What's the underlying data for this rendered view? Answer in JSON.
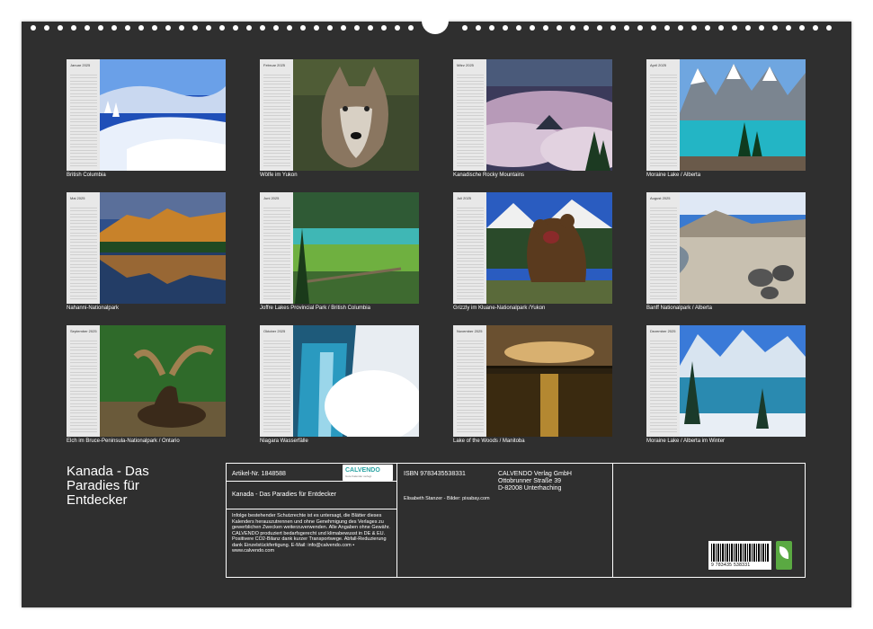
{
  "months": [
    {
      "month": "Januar 2025",
      "caption": "British Columbia",
      "scene": "snow"
    },
    {
      "month": "Februar 2025",
      "caption": "Wölfe im Yukon",
      "scene": "wolf"
    },
    {
      "month": "März 2025",
      "caption": "Kanadische Rocky Mountains",
      "scene": "clouds"
    },
    {
      "month": "April 2025",
      "caption": "Moraine Lake / Alberta",
      "scene": "lake"
    },
    {
      "month": "Mai 2025",
      "caption": "Nahanni-Nationalpark",
      "scene": "mountain-reflect"
    },
    {
      "month": "Juni 2025",
      "caption": "Joffre Lakes Provincial Park / British Columbia",
      "scene": "green-lake"
    },
    {
      "month": "Juli 2025",
      "caption": "Grizzly im Kluane-Nationalpark /Yukon",
      "scene": "bear"
    },
    {
      "month": "August 2025",
      "caption": "Banff Nationalpark / Alberta",
      "scene": "beach"
    },
    {
      "month": "September 2025",
      "caption": "Elch im Bruce-Peninsula-Nationalpark / Ontario",
      "scene": "moose"
    },
    {
      "month": "Oktober 2025",
      "caption": "Niagara Wasserfälle",
      "scene": "falls"
    },
    {
      "month": "November 2025",
      "caption": "Lake of the Woods / Manitoba",
      "scene": "sunset"
    },
    {
      "month": "Dezember 2025",
      "caption": "Moraine Lake / Alberta im Winter",
      "scene": "winter-lake"
    }
  ],
  "title": "Kanada - Das Paradies für Entdecker",
  "info": {
    "article": "Artikel-Nr. 1848588",
    "logo": "CALVENDO",
    "logo_sub": "Gute Kalender verlegt",
    "product_title": "Kanada - Das Paradies für Entdecker",
    "isbn": "ISBN 9783435538331",
    "publisher": [
      "CALVENDO Verlag GmbH",
      "Ottobrunner Straße 39",
      "D-82008 Unterhaching"
    ],
    "credits": "Elisabeth Stanzer - Bilder: pixabay.com",
    "legal": "Infolge bestehender Schutzrechte ist es untersagt, die Blätter dieses Kalenders herauszutrennen und ohne Genehmigung des Verlages zu gewerblichen Zwecken weiterzuverwenden. Alle Angaben ohne Gewähr. CALVENDO produziert bedarfsgerecht und klimabewusst in DE & EU. Positivere CO2-Bilanz dank kurzer Transportwege. Abfall-Reduzierung dank Einzelstückfertigung. E-Mail: info@calvendo.com • www.calvendo.com",
    "barcode_text": "9 783435 538331"
  }
}
